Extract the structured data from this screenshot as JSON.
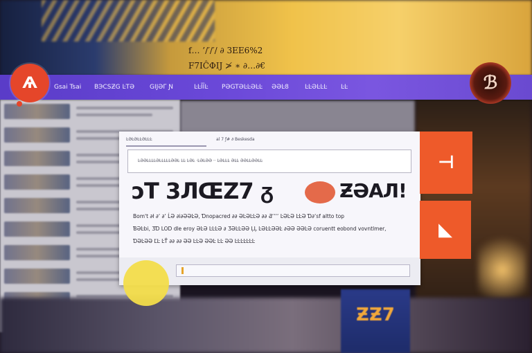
{
  "caption": {
    "line1": "f…  ’/′/′/  ∂  3EE6%2",
    "line2": "F7IĈΦIJ ≯  ∗  ∂…∂€"
  },
  "navbar": {
    "logo_glyph": "Ѧ",
    "items": [
      {
        "label": "Gsai Tsai"
      },
      {
        "label": "BЭCSƵG ĿTƏ"
      },
      {
        "label": "GĲƏΓ Ɲ"
      },
      {
        "label": "ĿĿĨĨĿ"
      },
      {
        "label": "PƏGTƏĿĿƏĿĿ"
      },
      {
        "label": "ƏƏĿ8"
      },
      {
        "label": "ĿĿƏĿĿĿ"
      },
      {
        "label": "ĿĿ"
      }
    ],
    "emblem_glyph": "ℬ"
  },
  "card": {
    "tab_primary": "ĿƏĿƏĿĿƏĿĿĿ",
    "tab_secondary": "al 7 ƒ# ∂  Beskesda",
    "search_text": "ĿƏƏĿĿĿĿƏĿĿĿĿĿƏƏĿ  ĿĿ  ĿƏĿ  ·ĿƏĿƏƏ  ··  ĿƏĿĿĿ  ƏĿĿ  ƏƏĿĿƏƏĿĿ",
    "headline_left": "ↄT 3ЛŒZ7 ᵹ",
    "headline_right": "ƵƏAЛ!",
    "body_lines": [
      "Bom't  ∂ł ∂ʼ ∂ʼ ĹƏ ∂i∂ƏƏĿƏ,  Ɗnopacred ∂∂ ƏĿƏĿĿƏ ∂∂ Ƌʼʼʼʼ ĿƏĿƏ ĿĿƏ Ɗ∂ʼsf altto top",
      "ƁƏĿbi,  ƷƊ  LOD  dle  eroy  ƏĿƏ  ĿĿĿƏ  ∂ ƷƏĿĿƏƏ  ĻĻ  ĿƏĿĿƏƏĿ  ∂ƏƏ  ƏƏĿƏ  coruentt  eobond  vovntlmer,",
      "ƊƏĿƏƏ  ĽĿ  ĿŤ  ∂∂  ∂∂  ƏƏ  ĿĿƏ  ƏƏĿ  ĿĿ  ƏƏ  ĿĿĿĿĿĿĿ"
    ]
  },
  "tiles": [
    {
      "glyph": "⊣"
    },
    {
      "glyph": "◣"
    }
  ],
  "poster": {
    "label": "ƵƵ7"
  },
  "colors": {
    "navbar": "#6a48d8",
    "logo": "#e5462a",
    "tile": "#ee5a2a",
    "card": "#f7f6fb"
  }
}
